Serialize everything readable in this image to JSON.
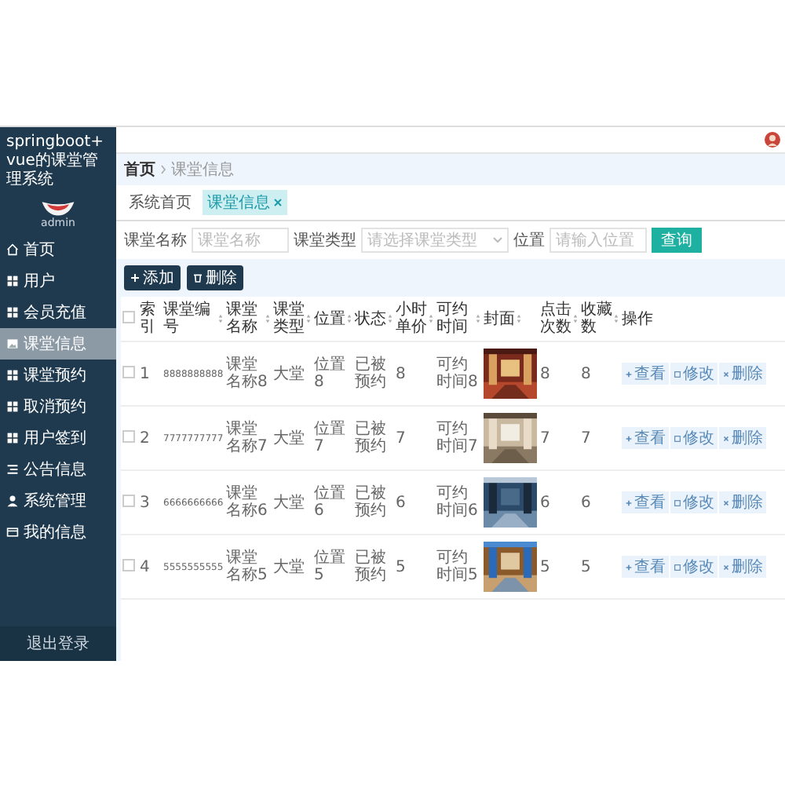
{
  "sidebar": {
    "title": "springboot+vue的课堂管理系统",
    "user": "admin",
    "items": [
      {
        "label": "首页",
        "selected": false
      },
      {
        "label": "用户",
        "selected": false
      },
      {
        "label": "会员充值",
        "selected": false
      },
      {
        "label": "课堂信息",
        "selected": true
      },
      {
        "label": "课堂预约",
        "selected": false
      },
      {
        "label": "取消预约",
        "selected": false
      },
      {
        "label": "用户签到",
        "selected": false
      },
      {
        "label": "公告信息",
        "selected": false
      },
      {
        "label": "系统管理",
        "selected": false
      },
      {
        "label": "我的信息",
        "selected": false
      }
    ],
    "footer": "退出登录"
  },
  "breadcrumb": [
    "首页",
    "课堂信息"
  ],
  "tabs": [
    {
      "label": "系统首页",
      "selected": false
    },
    {
      "label": "课堂信息",
      "selected": true
    }
  ],
  "search": {
    "fields": [
      {
        "label": "课堂名称",
        "placeholder": "课堂名称",
        "kind": "input"
      },
      {
        "label": "课堂类型",
        "placeholder": "请选择课堂类型",
        "kind": "select"
      },
      {
        "label": "位置",
        "placeholder": "请输入位置",
        "kind": "input"
      }
    ],
    "button": "查询"
  },
  "actions": [
    {
      "label": "添加",
      "kind": "add"
    },
    {
      "label": "删除",
      "kind": "delete"
    }
  ],
  "table": {
    "all_checked": false,
    "columns": [
      {
        "label": "索引",
        "sortable": false
      },
      {
        "label": "课堂编号",
        "sortable": true
      },
      {
        "label": "课堂名称",
        "sortable": true
      },
      {
        "label": "课堂类型",
        "sortable": true
      },
      {
        "label": "位置",
        "sortable": true
      },
      {
        "label": "状态",
        "sortable": true
      },
      {
        "label": "小时单价",
        "sortable": true
      },
      {
        "label": "可约时间",
        "sortable": true
      },
      {
        "label": "封面",
        "sortable": true
      },
      {
        "label": "点击次数",
        "sortable": true
      },
      {
        "label": "收藏数",
        "sortable": true
      },
      {
        "label": "操作",
        "sortable": false
      }
    ],
    "rows": [
      {
        "checked": false,
        "cells": [
          "1",
          "8888888888",
          "课堂名称8",
          "大堂",
          "位置8",
          "已被预约",
          "8",
          "可约时间8"
        ],
        "clicks": "8",
        "favorites": "8",
        "actions": [
          {
            "label": "查看",
            "kind": "view"
          },
          {
            "label": "修改",
            "kind": "edit"
          },
          {
            "label": "删除",
            "kind": "delete"
          }
        ]
      },
      {
        "checked": false,
        "cells": [
          "2",
          "7777777777",
          "课堂名称7",
          "大堂",
          "位置7",
          "已被预约",
          "7",
          "可约时间7"
        ],
        "clicks": "7",
        "favorites": "7",
        "actions": [
          {
            "label": "查看",
            "kind": "view"
          },
          {
            "label": "修改",
            "kind": "edit"
          },
          {
            "label": "删除",
            "kind": "delete"
          }
        ]
      },
      {
        "checked": false,
        "cells": [
          "3",
          "6666666666",
          "课堂名称6",
          "大堂",
          "位置6",
          "已被预约",
          "6",
          "可约时间6"
        ],
        "clicks": "6",
        "favorites": "6",
        "actions": [
          {
            "label": "查看",
            "kind": "view"
          },
          {
            "label": "修改",
            "kind": "edit"
          },
          {
            "label": "删除",
            "kind": "delete"
          }
        ]
      },
      {
        "checked": false,
        "cells": [
          "4",
          "5555555555",
          "课堂名称5",
          "大堂",
          "位置5",
          "已被预约",
          "5",
          "可约时间5"
        ],
        "clicks": "5",
        "favorites": "5",
        "actions": [
          {
            "label": "查看",
            "kind": "view"
          },
          {
            "label": "修改",
            "kind": "edit"
          },
          {
            "label": "删除",
            "kind": "delete"
          }
        ]
      }
    ]
  }
}
